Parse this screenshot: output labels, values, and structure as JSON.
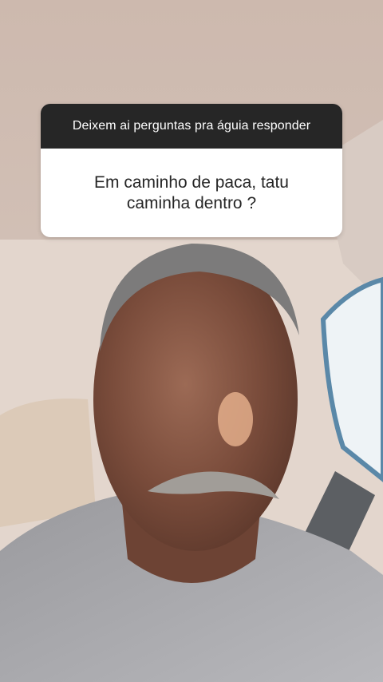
{
  "question_sticker": {
    "prompt": "Deixem ai perguntas pra águia responder",
    "answer": "Em caminho de paca, tatu caminha dentro ?"
  },
  "colors": {
    "header_bg": "#262626",
    "header_text": "#ffffff",
    "body_bg": "#ffffff",
    "body_text": "#262626"
  }
}
